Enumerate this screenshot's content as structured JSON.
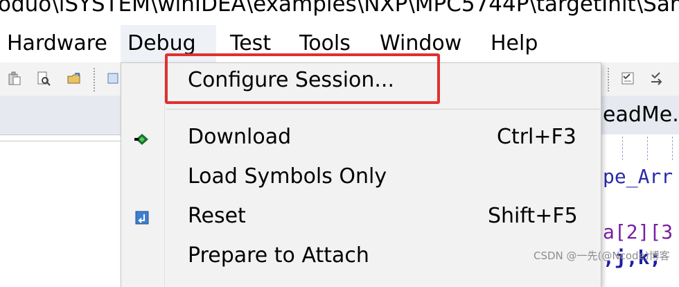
{
  "title_bar": {
    "path_text": "oduo\\iSYSTEM\\winIDEA\\examples\\NXP\\MPC5744P\\targetInit\\Sam"
  },
  "menubar": {
    "items": [
      {
        "label": "Hardware",
        "key": "hardware"
      },
      {
        "label": "Debug",
        "key": "debug"
      },
      {
        "label": "Test",
        "key": "test"
      },
      {
        "label": "Tools",
        "key": "tools"
      },
      {
        "label": "Window",
        "key": "window"
      },
      {
        "label": "Help",
        "key": "help"
      }
    ]
  },
  "debug_menu": {
    "configure_session": "Configure Session...",
    "download": "Download",
    "download_shortcut": "Ctrl+F3",
    "load_symbols": "Load Symbols Only",
    "reset": "Reset",
    "reset_shortcut": "Shift+F5",
    "prepare_attach": "Prepare to Attach"
  },
  "editor": {
    "tab_label": "eadMe.t",
    "lines": [
      "pe_Arr",
      "a[2][3",
      ",j,k;"
    ]
  },
  "watermark": "CSDN @一先(@Ncode)博客"
}
